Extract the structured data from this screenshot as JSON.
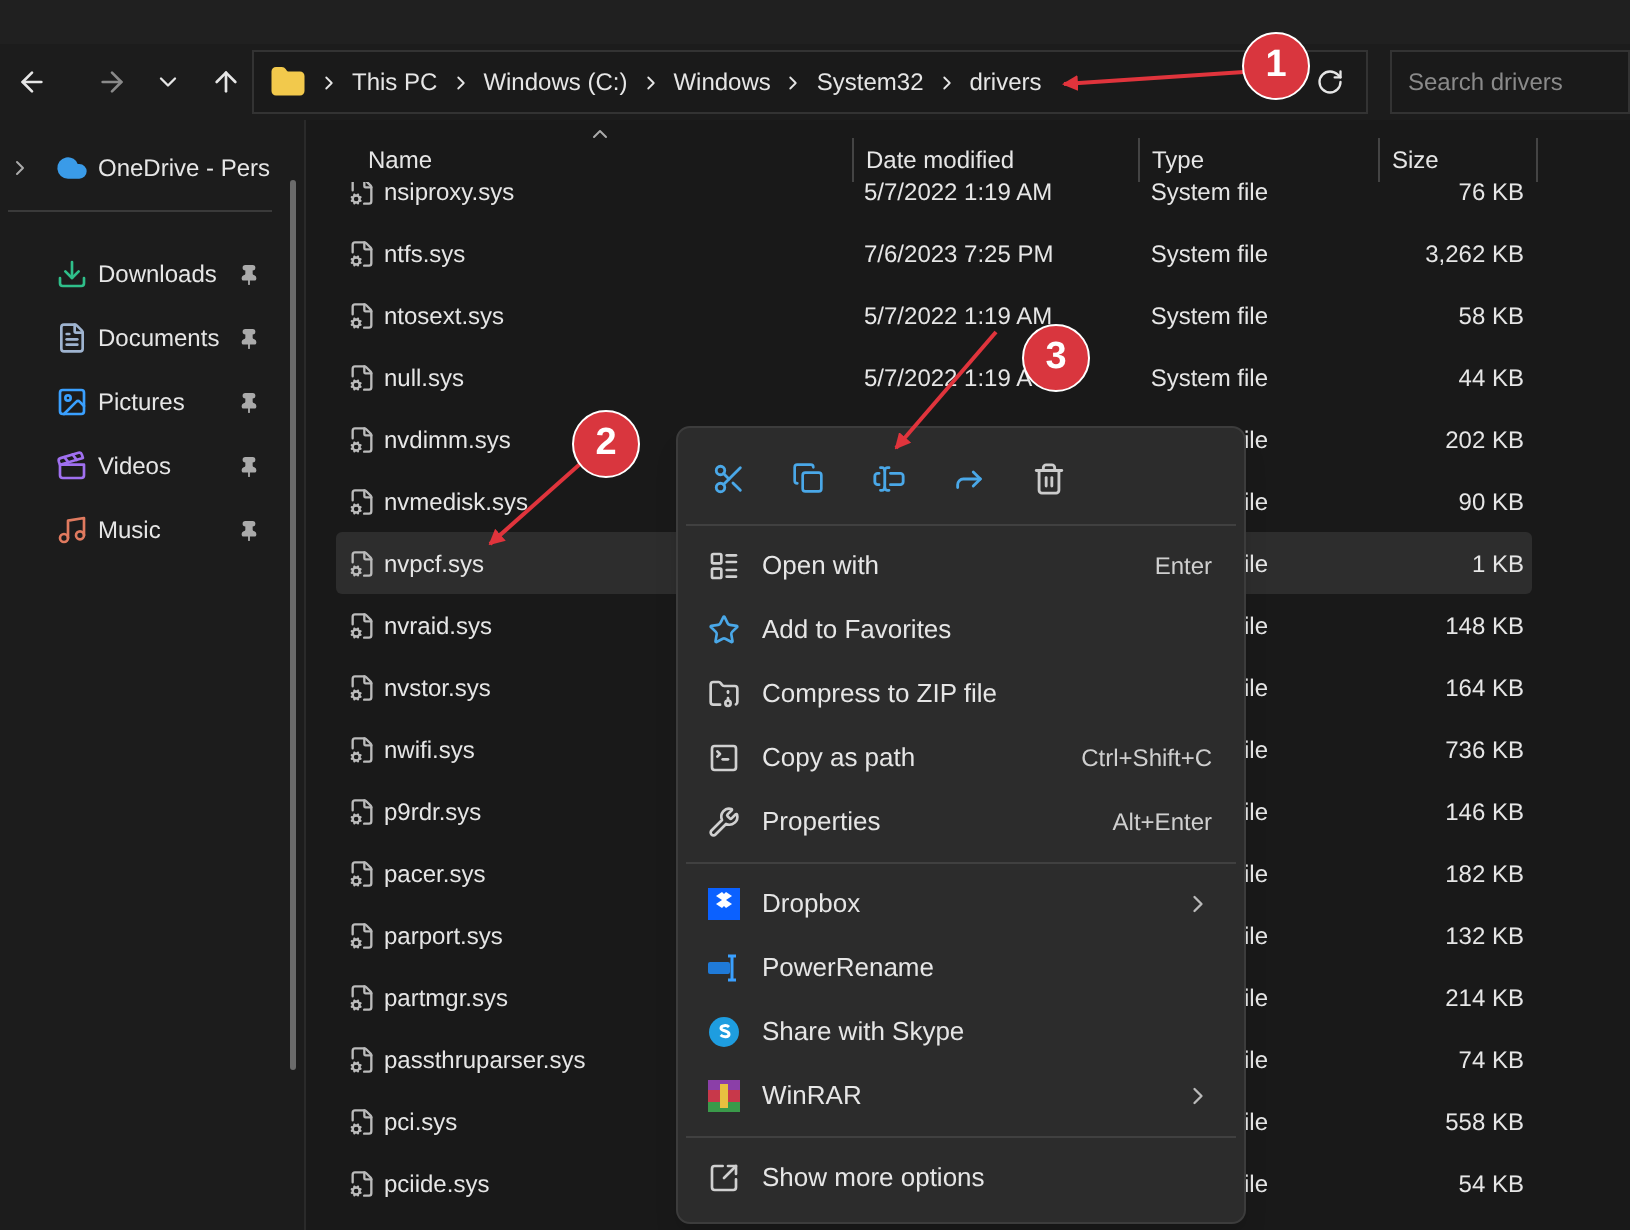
{
  "address_bar": {
    "crumbs": [
      "This PC",
      "Windows (C:)",
      "Windows",
      "System32",
      "drivers"
    ]
  },
  "search": {
    "placeholder": "Search drivers"
  },
  "sidebar": {
    "items": [
      {
        "label": "OneDrive - Pers",
        "kind": "cloud"
      },
      {
        "label": "Downloads",
        "kind": "downloads"
      },
      {
        "label": "Documents",
        "kind": "documents"
      },
      {
        "label": "Pictures",
        "kind": "pictures"
      },
      {
        "label": "Videos",
        "kind": "videos"
      },
      {
        "label": "Music",
        "kind": "music"
      }
    ]
  },
  "table": {
    "columns": [
      "Name",
      "Date modified",
      "Type",
      "Size"
    ],
    "rows": [
      {
        "name": "nsiproxy.sys",
        "date": "5/7/2022 1:19 AM",
        "type": "System file",
        "size": "76 KB",
        "selected": false
      },
      {
        "name": "ntfs.sys",
        "date": "7/6/2023 7:25 PM",
        "type": "System file",
        "size": "3,262 KB",
        "selected": false
      },
      {
        "name": "ntosext.sys",
        "date": "5/7/2022 1:19 AM",
        "type": "System file",
        "size": "58 KB",
        "selected": false
      },
      {
        "name": "null.sys",
        "date": "5/7/2022 1:19 A",
        "type": "System file",
        "size": "44 KB",
        "selected": false
      },
      {
        "name": "nvdimm.sys",
        "type": "ile",
        "size": "202 KB",
        "selected": false
      },
      {
        "name": "nvmedisk.sys",
        "type": "ile",
        "size": "90 KB",
        "selected": false
      },
      {
        "name": "nvpcf.sys",
        "type": "ile",
        "size": "1 KB",
        "selected": true
      },
      {
        "name": "nvraid.sys",
        "type": "ile",
        "size": "148 KB",
        "selected": false
      },
      {
        "name": "nvstor.sys",
        "type": "ile",
        "size": "164 KB",
        "selected": false
      },
      {
        "name": "nwifi.sys",
        "type": "ile",
        "size": "736 KB",
        "selected": false
      },
      {
        "name": "p9rdr.sys",
        "type": "ile",
        "size": "146 KB",
        "selected": false
      },
      {
        "name": "pacer.sys",
        "type": "ile",
        "size": "182 KB",
        "selected": false
      },
      {
        "name": "parport.sys",
        "type": "ile",
        "size": "132 KB",
        "selected": false
      },
      {
        "name": "partmgr.sys",
        "type": "ile",
        "size": "214 KB",
        "selected": false
      },
      {
        "name": "passthruparser.sys",
        "type": "ile",
        "size": "74 KB",
        "selected": false
      },
      {
        "name": "pci.sys",
        "type": "ile",
        "size": "558 KB",
        "selected": false
      },
      {
        "name": "pciide.sys",
        "type": "ile",
        "size": "54 KB",
        "selected": false
      }
    ]
  },
  "context_menu": {
    "sections": [
      [
        {
          "label": "Open with",
          "shortcut": "Enter",
          "kind": "openwith",
          "submenu": false
        },
        {
          "label": "Add to Favorites",
          "kind": "favorite",
          "submenu": false
        },
        {
          "label": "Compress to ZIP file",
          "kind": "zip",
          "submenu": false
        },
        {
          "label": "Copy as path",
          "shortcut": "Ctrl+Shift+C",
          "kind": "path",
          "submenu": false
        },
        {
          "label": "Properties",
          "shortcut": "Alt+Enter",
          "kind": "properties",
          "submenu": false
        }
      ],
      [
        {
          "label": "Dropbox",
          "kind": "dropbox",
          "submenu": true
        },
        {
          "label": "PowerRename",
          "kind": "powerrename",
          "submenu": false
        },
        {
          "label": "Share with Skype",
          "kind": "skype",
          "submenu": false
        },
        {
          "label": "WinRAR",
          "kind": "winrar",
          "submenu": true
        }
      ],
      [
        {
          "label": "Show more options",
          "kind": "more",
          "submenu": false
        }
      ]
    ]
  },
  "callouts": [
    "1",
    "2",
    "3"
  ]
}
